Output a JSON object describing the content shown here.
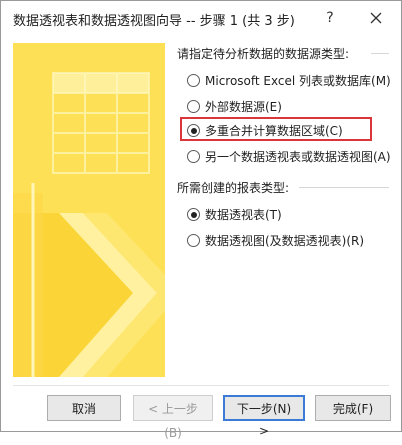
{
  "window": {
    "title": "数据透视表和数据透视图向导 -- 步骤 1 (共 3 步)",
    "help_glyph": "?"
  },
  "data_source": {
    "label": "请指定待分析数据的数据源类型:",
    "options": [
      {
        "label": "Microsoft Excel 列表或数据库(M)",
        "selected": false
      },
      {
        "label": "外部数据源(E)",
        "selected": false
      },
      {
        "label": "多重合并计算数据区域(C)",
        "selected": true
      },
      {
        "label": "另一个数据透视表或数据透视图(A)",
        "selected": false
      }
    ]
  },
  "report_type": {
    "label": "所需创建的报表类型:",
    "options": [
      {
        "label": "数据透视表(T)",
        "selected": true
      },
      {
        "label": "数据透视图(及数据透视表)(R)",
        "selected": false
      }
    ]
  },
  "buttons": {
    "cancel": "取消",
    "back": "< 上一步(B)",
    "next": "下一步(N) >",
    "finish": "完成(F)"
  },
  "colors": {
    "art_fill": "#fde055",
    "highlight": "#d9353a",
    "default_button": "#3b7bd6"
  }
}
